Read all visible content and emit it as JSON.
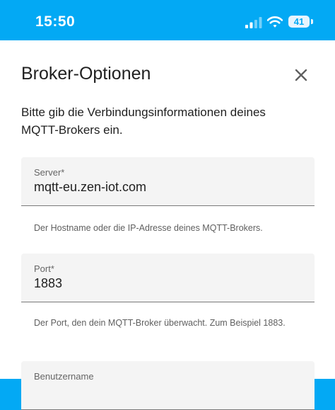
{
  "status_bar": {
    "time": "15:50",
    "battery": "41",
    "icons": [
      "signal-icon",
      "wifi-icon",
      "battery-icon"
    ]
  },
  "dialog": {
    "title": "Broker-Optionen",
    "close_icon": "close-icon",
    "description": "Bitte gib die Verbindungsinformationen deines MQTT-Brokers ein.",
    "fields": [
      {
        "label": "Server*",
        "value": "mqtt-eu.zen-iot.com",
        "helper": "Der Hostname oder die IP-Adresse deines MQTT-Brokers."
      },
      {
        "label": "Port*",
        "value": "1883",
        "helper": "Der Port, den dein MQTT-Broker überwacht. Zum Beispiel 1883."
      },
      {
        "label": "Benutzername",
        "value": ""
      }
    ]
  },
  "colors": {
    "accent": "#03a9f4",
    "field_background": "#f4f4f4",
    "text": "#212121"
  }
}
